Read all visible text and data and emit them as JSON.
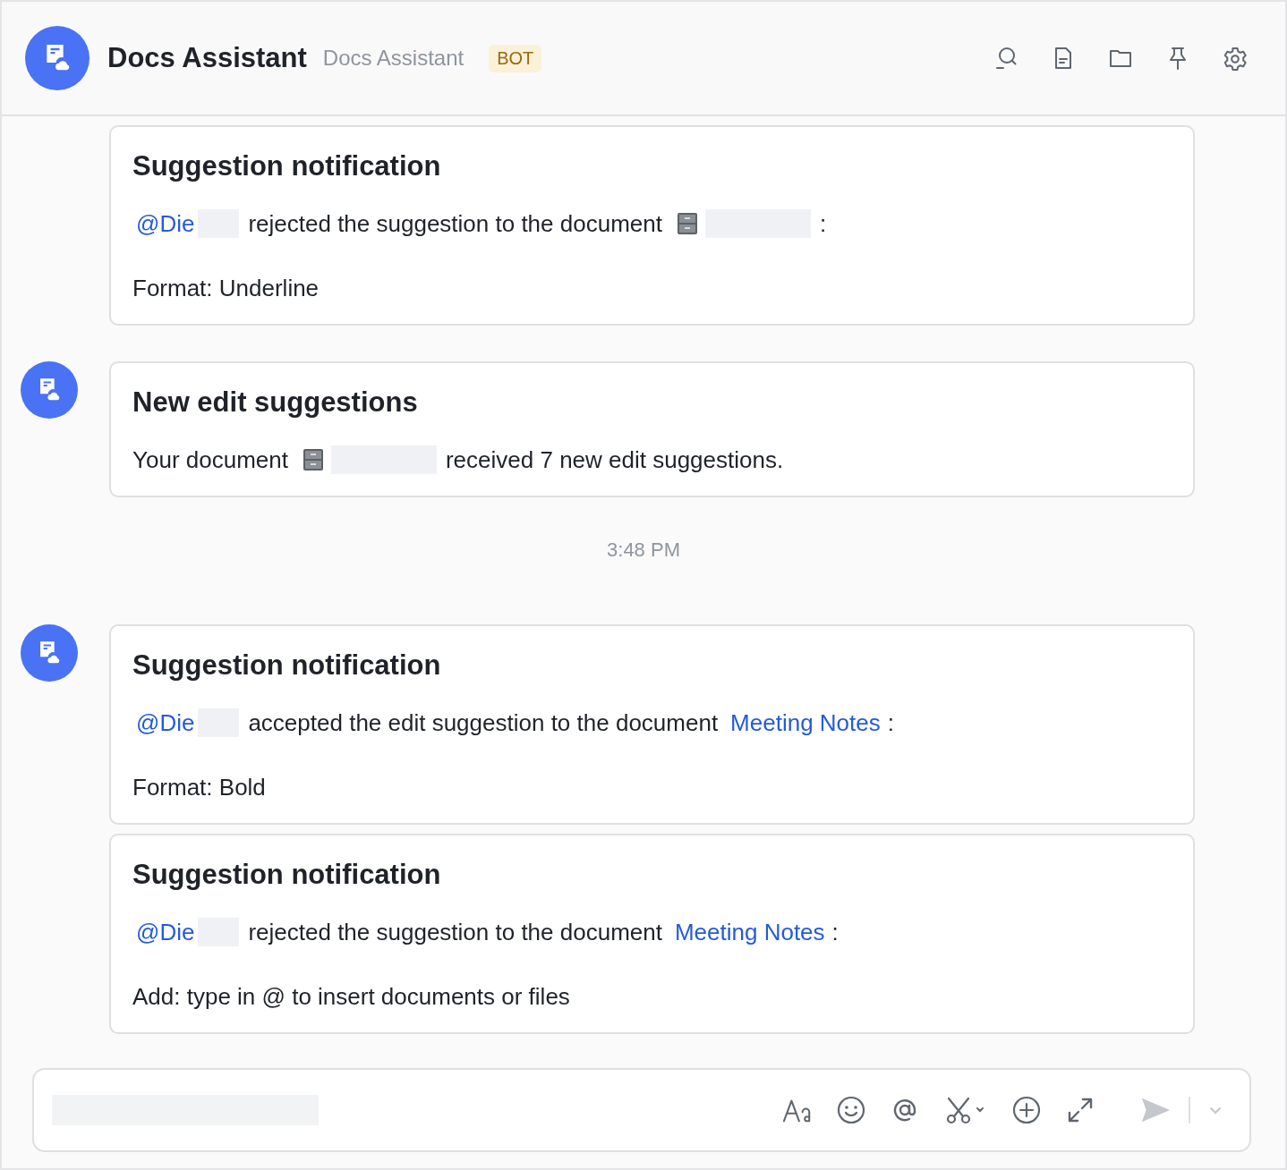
{
  "header": {
    "title": "Docs Assistant",
    "subtitle": "Docs Assistant",
    "badge": "BOT"
  },
  "feed": [
    {
      "kind": "message",
      "avatar": false,
      "cards": [
        {
          "title": "Suggestion notification",
          "paragraphs": [
            [
              {
                "kind": "mention",
                "text": "@Die"
              },
              {
                "kind": "redacted_name"
              },
              {
                "kind": "text",
                "text": "rejected the suggestion to the document"
              },
              {
                "kind": "doc_icon"
              },
              {
                "kind": "redacted_title"
              },
              {
                "kind": "text",
                "text": ":"
              }
            ],
            [
              {
                "kind": "text",
                "text": "Format: Underline"
              }
            ]
          ]
        }
      ]
    },
    {
      "kind": "message",
      "avatar": true,
      "cards": [
        {
          "title": "New edit suggestions",
          "paragraphs": [
            [
              {
                "kind": "text",
                "text": "Your document"
              },
              {
                "kind": "doc_icon"
              },
              {
                "kind": "redacted_title"
              },
              {
                "kind": "text",
                "text": "received 7 new edit suggestions."
              }
            ]
          ]
        }
      ]
    },
    {
      "kind": "time",
      "text": "3:48 PM"
    },
    {
      "kind": "message",
      "avatar": true,
      "cards": [
        {
          "title": "Suggestion notification",
          "paragraphs": [
            [
              {
                "kind": "mention",
                "text": "@Die"
              },
              {
                "kind": "redacted_name"
              },
              {
                "kind": "text",
                "text": "accepted the edit suggestion to the document"
              },
              {
                "kind": "link",
                "text": "Meeting Notes"
              },
              {
                "kind": "text",
                "text": ":"
              }
            ],
            [
              {
                "kind": "text",
                "text": "Format: Bold"
              }
            ]
          ]
        },
        {
          "title": "Suggestion notification",
          "paragraphs": [
            [
              {
                "kind": "mention",
                "text": "@Die"
              },
              {
                "kind": "redacted_name"
              },
              {
                "kind": "text",
                "text": "rejected the suggestion to the document"
              },
              {
                "kind": "link",
                "text": "Meeting Notes"
              },
              {
                "kind": "text",
                "text": ":"
              }
            ],
            [
              {
                "kind": "text",
                "text": "Add: type in @ to insert documents or files"
              }
            ]
          ]
        }
      ]
    }
  ]
}
